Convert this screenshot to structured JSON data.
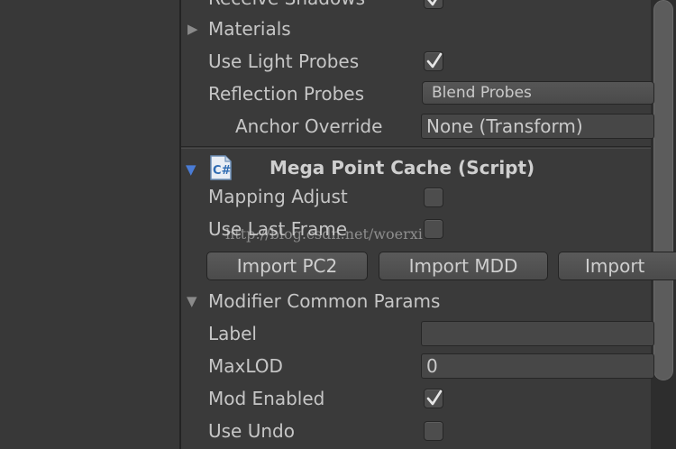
{
  "rows": {
    "receive_shadows": "Receive Shadows",
    "materials": "Materials",
    "use_light_probes": "Use Light Probes",
    "reflection_probes": "Reflection Probes",
    "reflection_probes_value": "Blend Probes",
    "anchor_override": "Anchor Override",
    "anchor_override_value": "None (Transform)"
  },
  "component": {
    "title": "Mega Point Cache (Script)",
    "icon": "csharp-script-icon",
    "mapping_adjust": "Mapping Adjust",
    "use_last_frame": "Use Last Frame",
    "buttons": [
      "Import PC2",
      "Import MDD",
      "Import"
    ]
  },
  "modifier": {
    "section": "Modifier Common Params",
    "label": "Label",
    "label_value": "",
    "maxlod": "MaxLOD",
    "maxlod_value": "0",
    "mod_enabled": "Mod Enabled",
    "use_undo": "Use Undo"
  },
  "watermark": "http://blog.csdn.net/woerxi"
}
